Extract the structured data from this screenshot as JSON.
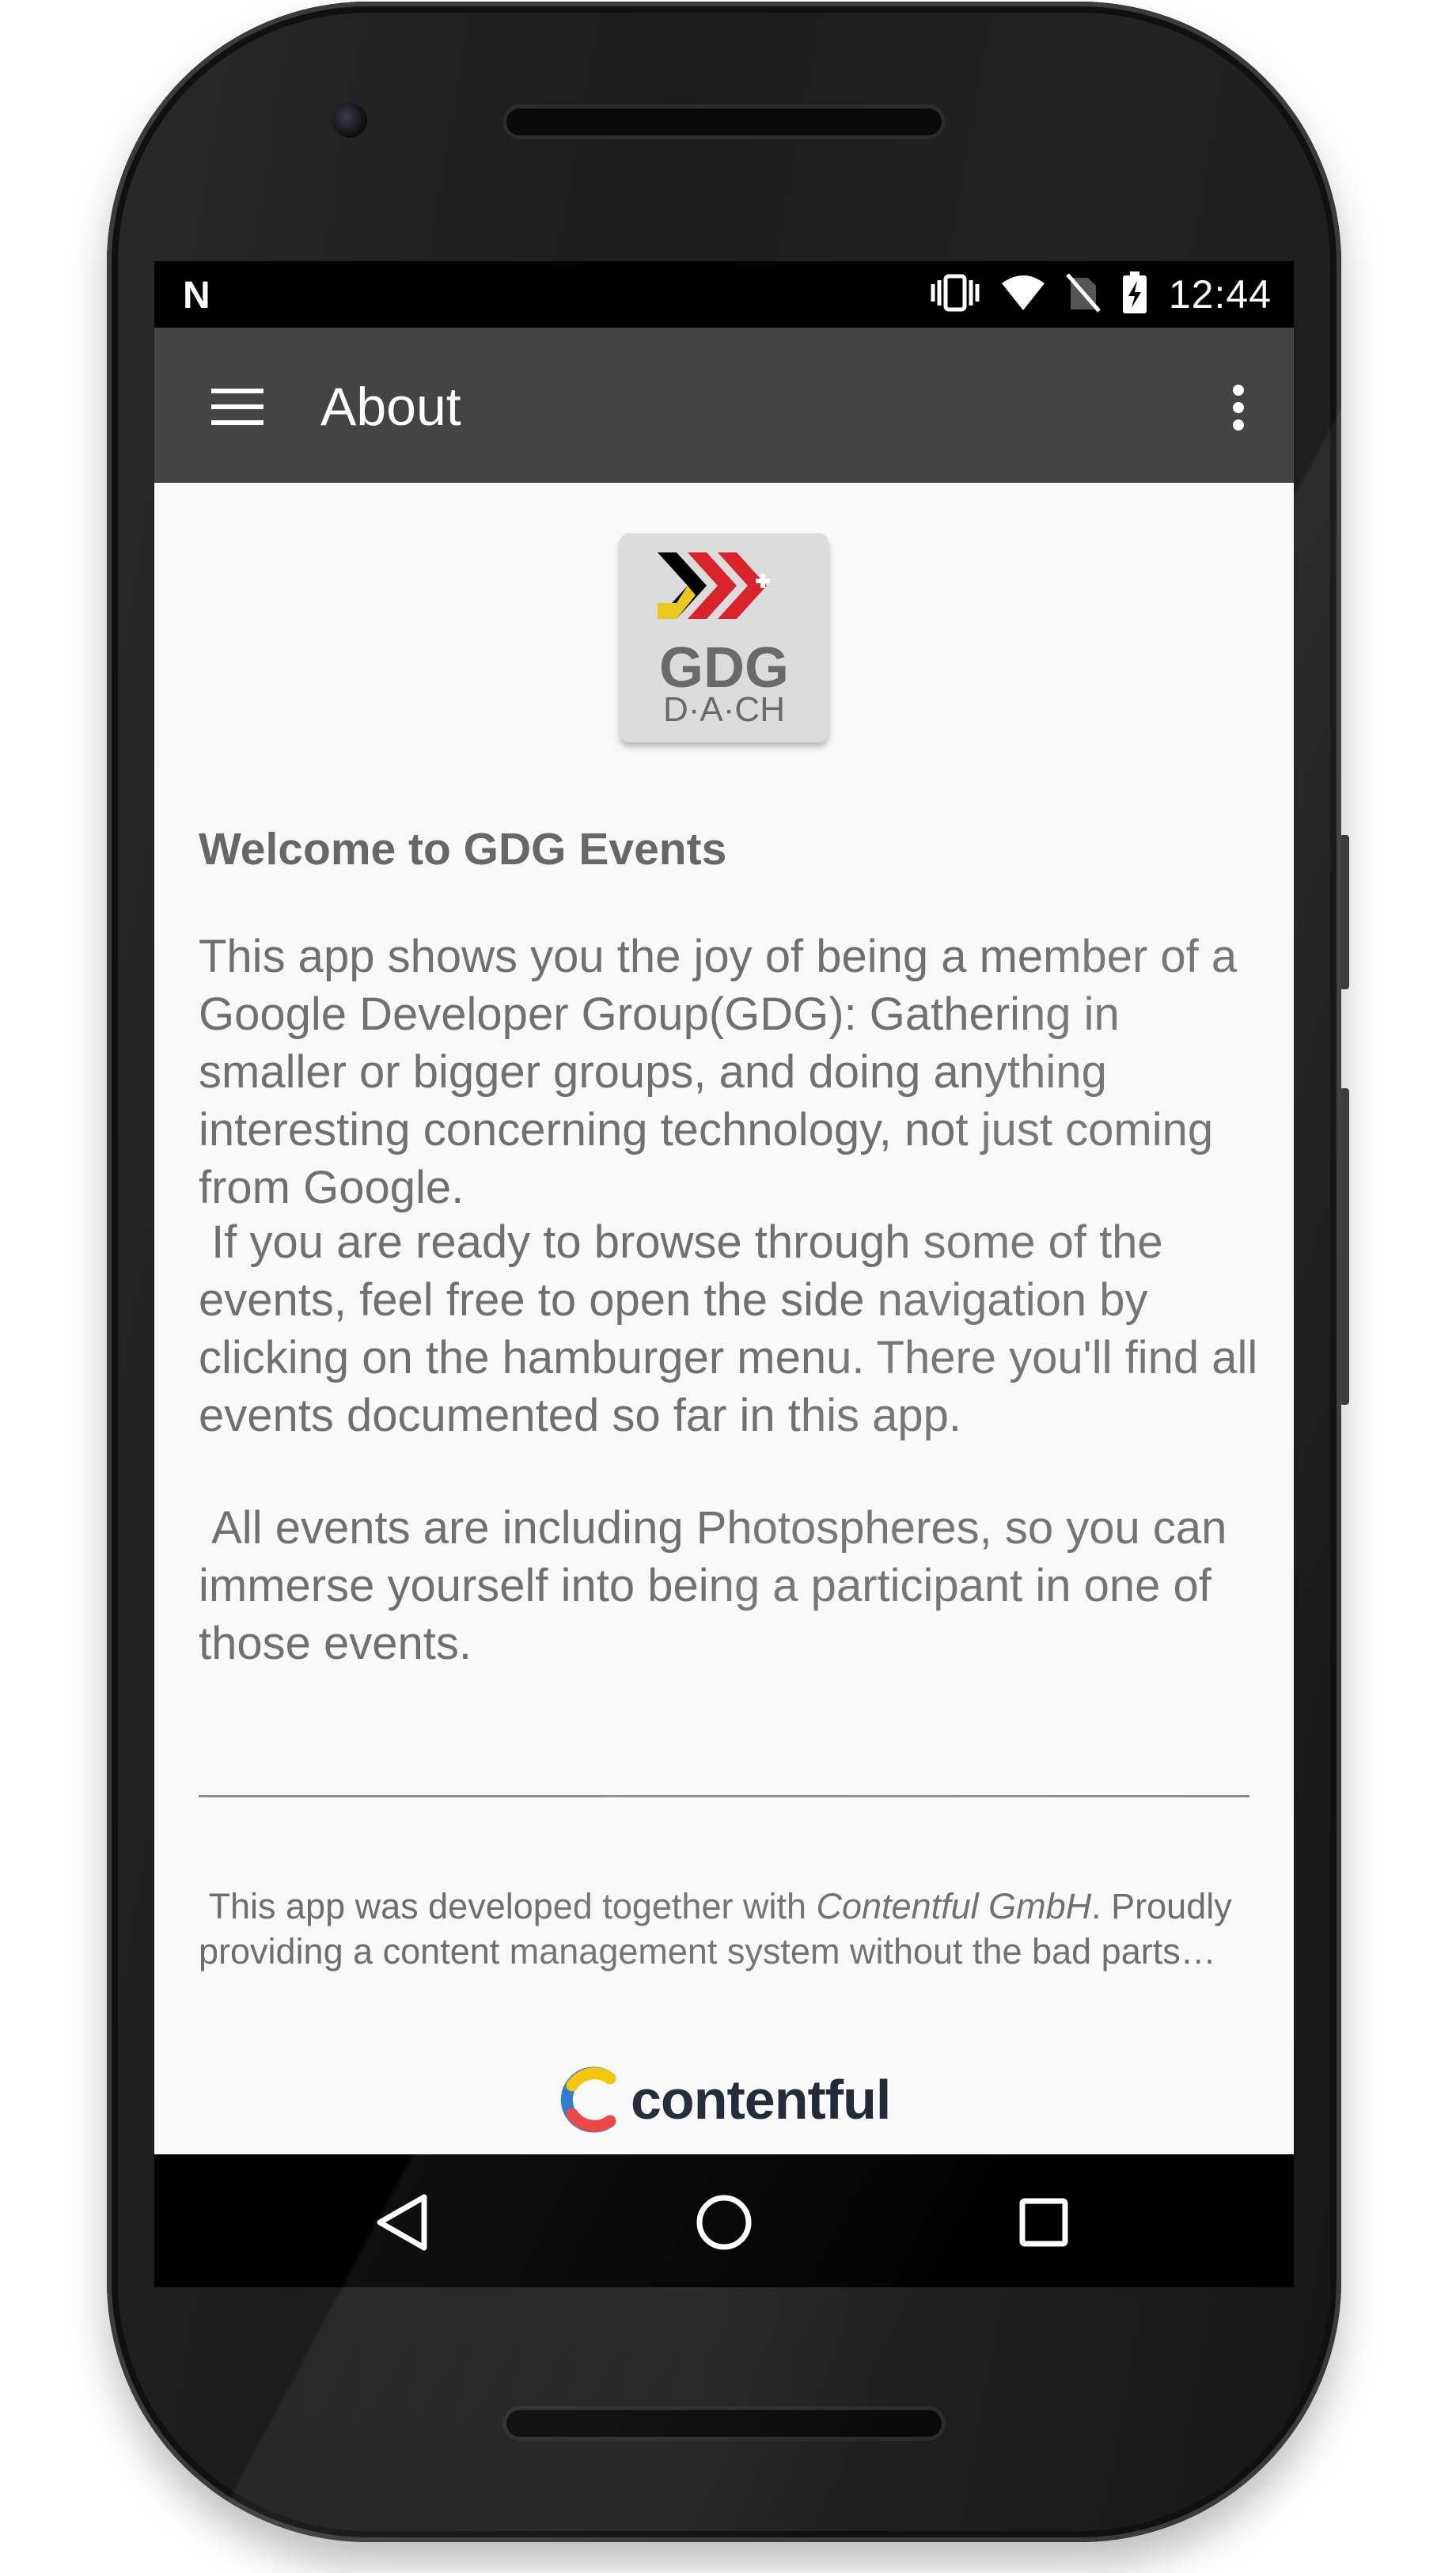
{
  "status_bar": {
    "brand_glyph": "N",
    "time": "12:44",
    "icons": [
      "vibrate-icon",
      "wifi-icon",
      "no-sim-icon",
      "battery-charging-icon"
    ]
  },
  "toolbar": {
    "title": "About",
    "menu_icon": "hamburger-menu-icon",
    "overflow_icon": "more-vert-icon"
  },
  "logo": {
    "line1": "GDG",
    "line2": "D·A·CH"
  },
  "about": {
    "heading": "Welcome to GDG Events",
    "paragraphs": [
      "This app shows you the joy of being a member of a Google Developer Group(GDG): Gathering in smaller or bigger groups, and doing anything interesting concerning technology, not just coming from Google.",
      " If you are ready to browse through some of the events, feel free to open the side navigation by clicking on the hamburger menu. There you'll find all events documented so far in this app.",
      " All events are including Photospheres, so you can immerse yourself into being a participant in one of those events."
    ]
  },
  "footer": {
    "text_before": " This app was developed together with ",
    "company": "Contentful GmbH",
    "text_after": ". Proudly providing a content management system without the bad parts…",
    "brand_word": "contentful"
  },
  "nav_bar": {
    "buttons": [
      "back-icon",
      "home-icon",
      "recents-icon"
    ]
  },
  "colors": {
    "toolbar": "#444444",
    "content_background": "#f9f9f9",
    "body_text": "#707070",
    "status_bar": "#000000"
  }
}
